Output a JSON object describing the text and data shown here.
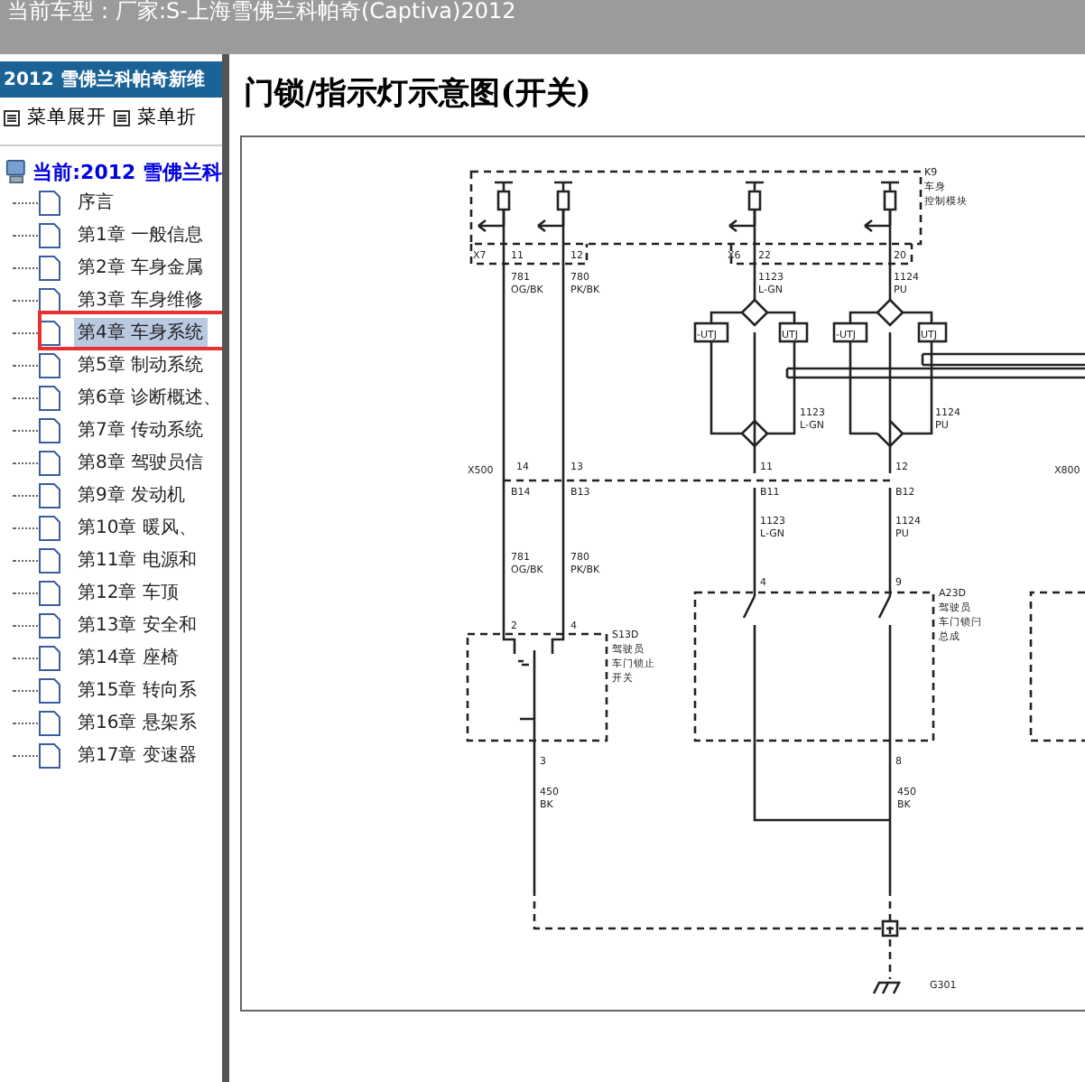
{
  "window": {
    "title": "当前车型：厂家:S-上海雪佛兰科帕奇(Captiva)2012"
  },
  "sidebar": {
    "title": "2012 雪佛兰科帕奇新维",
    "toolbar": [
      "菜单展开",
      "菜单折"
    ],
    "root": "当前:2012 雪佛兰科",
    "items": [
      {
        "label": "序言",
        "selected": false
      },
      {
        "label": "第1章 一般信息",
        "selected": false
      },
      {
        "label": "第2章 车身金属",
        "selected": false
      },
      {
        "label": "第3章 车身维修",
        "selected": false
      },
      {
        "label": "第4章 车身系统",
        "selected": true
      },
      {
        "label": "第5章 制动系统",
        "selected": false
      },
      {
        "label": "第6章 诊断概述、",
        "selected": false
      },
      {
        "label": "第7章 传动系统",
        "selected": false
      },
      {
        "label": "第8章 驾驶员信",
        "selected": false
      },
      {
        "label": "第9章 发动机",
        "selected": false
      },
      {
        "label": "第10章 暖风、",
        "selected": false
      },
      {
        "label": "第11章 电源和",
        "selected": false
      },
      {
        "label": "第12章 车顶",
        "selected": false
      },
      {
        "label": "第13章 安全和",
        "selected": false
      },
      {
        "label": "第14章 座椅",
        "selected": false
      },
      {
        "label": "第15章 转向系",
        "selected": false
      },
      {
        "label": "第16章 悬架系",
        "selected": false
      },
      {
        "label": "第17章 变速器",
        "selected": false
      }
    ]
  },
  "content": {
    "heading": "门锁/指示灯示意图(开关)",
    "diagram_labels": [
      "K9",
      "车身",
      "控制模块",
      "X7",
      "11",
      "12",
      "X6",
      "22",
      "20",
      "781",
      "OG/BK",
      "780",
      "PK/BK",
      "1123",
      "L-GN",
      "1124",
      "PU",
      "-UTJ",
      "UTJ",
      "-UTJ",
      "UTJ",
      "1123",
      "L-GN",
      "1124",
      "PU",
      "X500",
      "14",
      "B14",
      "13",
      "B13",
      "11",
      "B11",
      "12",
      "B12",
      "X800",
      "1123",
      "L-GN",
      "1124",
      "PU",
      "781",
      "OG/BK",
      "780",
      "PK/BK",
      "2",
      "4",
      "S13D",
      "驾驶员",
      "车门锁止",
      "开关",
      "4",
      "9",
      "A23D",
      "驾驶员",
      "车门锁闩",
      "总成",
      "3",
      "450",
      "BK",
      "8",
      "450",
      "BK",
      "G301"
    ]
  }
}
